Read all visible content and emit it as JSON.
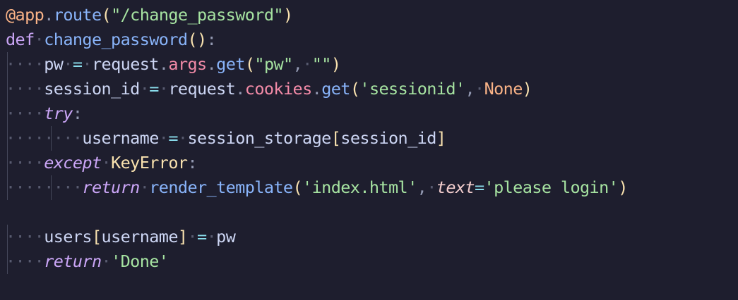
{
  "code": {
    "l1_decorator": "@app",
    "l1_route": "route",
    "l1_path": "\"/change_password\"",
    "l2_def": "def",
    "l2_fn": "change_password",
    "l3_var": "pw",
    "l3_request": "request",
    "l3_args": "args",
    "l3_get": "get",
    "l3_key": "\"pw\"",
    "l3_default": "\"\"",
    "l4_var": "session_id",
    "l4_request": "request",
    "l4_cookies": "cookies",
    "l4_get": "get",
    "l4_key": "'sessionid'",
    "l4_none": "None",
    "l5_try": "try",
    "l6_var": "username",
    "l6_storage": "session_storage",
    "l6_key": "session_id",
    "l7_except": "except",
    "l7_error": "KeyError",
    "l8_return": "return",
    "l8_fn": "render_template",
    "l8_template": "'index.html'",
    "l8_param": "text",
    "l8_msg": "'please login'",
    "l10_users": "users",
    "l10_key": "username",
    "l10_value": "pw",
    "l11_return": "return",
    "l11_value": "'Done'"
  },
  "colors": {
    "background": "#1e1e2e",
    "keyword": "#cba6f7",
    "function": "#89b4fa",
    "string": "#a6e3a1",
    "property": "#f38ba8",
    "class": "#f9e2af"
  }
}
